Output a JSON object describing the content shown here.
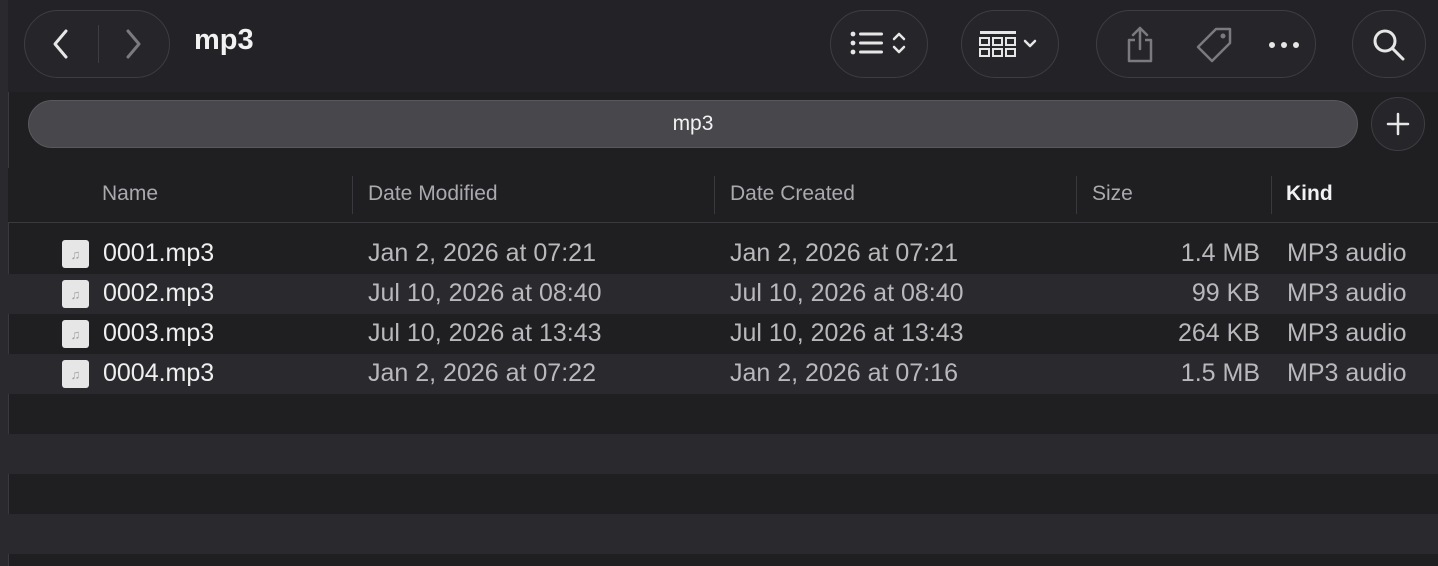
{
  "window": {
    "title": "mp3"
  },
  "toolbar": {
    "back_icon": "chevron-left-icon",
    "forward_icon": "chevron-right-icon",
    "view_icon": "list-view-icon",
    "group_icon": "group-grid-icon",
    "share_icon": "share-icon",
    "tag_icon": "tag-icon",
    "more_icon": "ellipsis-icon",
    "search_icon": "search-icon"
  },
  "tabbar": {
    "label": "mp3",
    "add_icon": "plus-icon"
  },
  "columns": {
    "name": "Name",
    "modified": "Date Modified",
    "created": "Date Created",
    "size": "Size",
    "kind": "Kind"
  },
  "files": [
    {
      "name": "0001.mp3",
      "modified": "Jan 2, 2026 at 07:21",
      "created": "Jan 2, 2026 at 07:21",
      "size": "1.4 MB",
      "kind": "MP3 audio"
    },
    {
      "name": "0002.mp3",
      "modified": "Jul 10, 2026 at 08:40",
      "created": "Jul 10, 2026 at 08:40",
      "size": "99 KB",
      "kind": "MP3 audio"
    },
    {
      "name": "0003.mp3",
      "modified": "Jul 10, 2026 at 13:43",
      "created": "Jul 10, 2026 at 13:43",
      "size": "264 KB",
      "kind": "MP3 audio"
    },
    {
      "name": "0004.mp3",
      "modified": "Jan 2, 2026 at 07:22",
      "created": "Jan 2, 2026 at 07:16",
      "size": "1.5 MB",
      "kind": "MP3 audio"
    }
  ],
  "colors": {
    "background": "#1f1f22",
    "alt_row": "#2a2a2e",
    "tabbar": "#47474c"
  }
}
